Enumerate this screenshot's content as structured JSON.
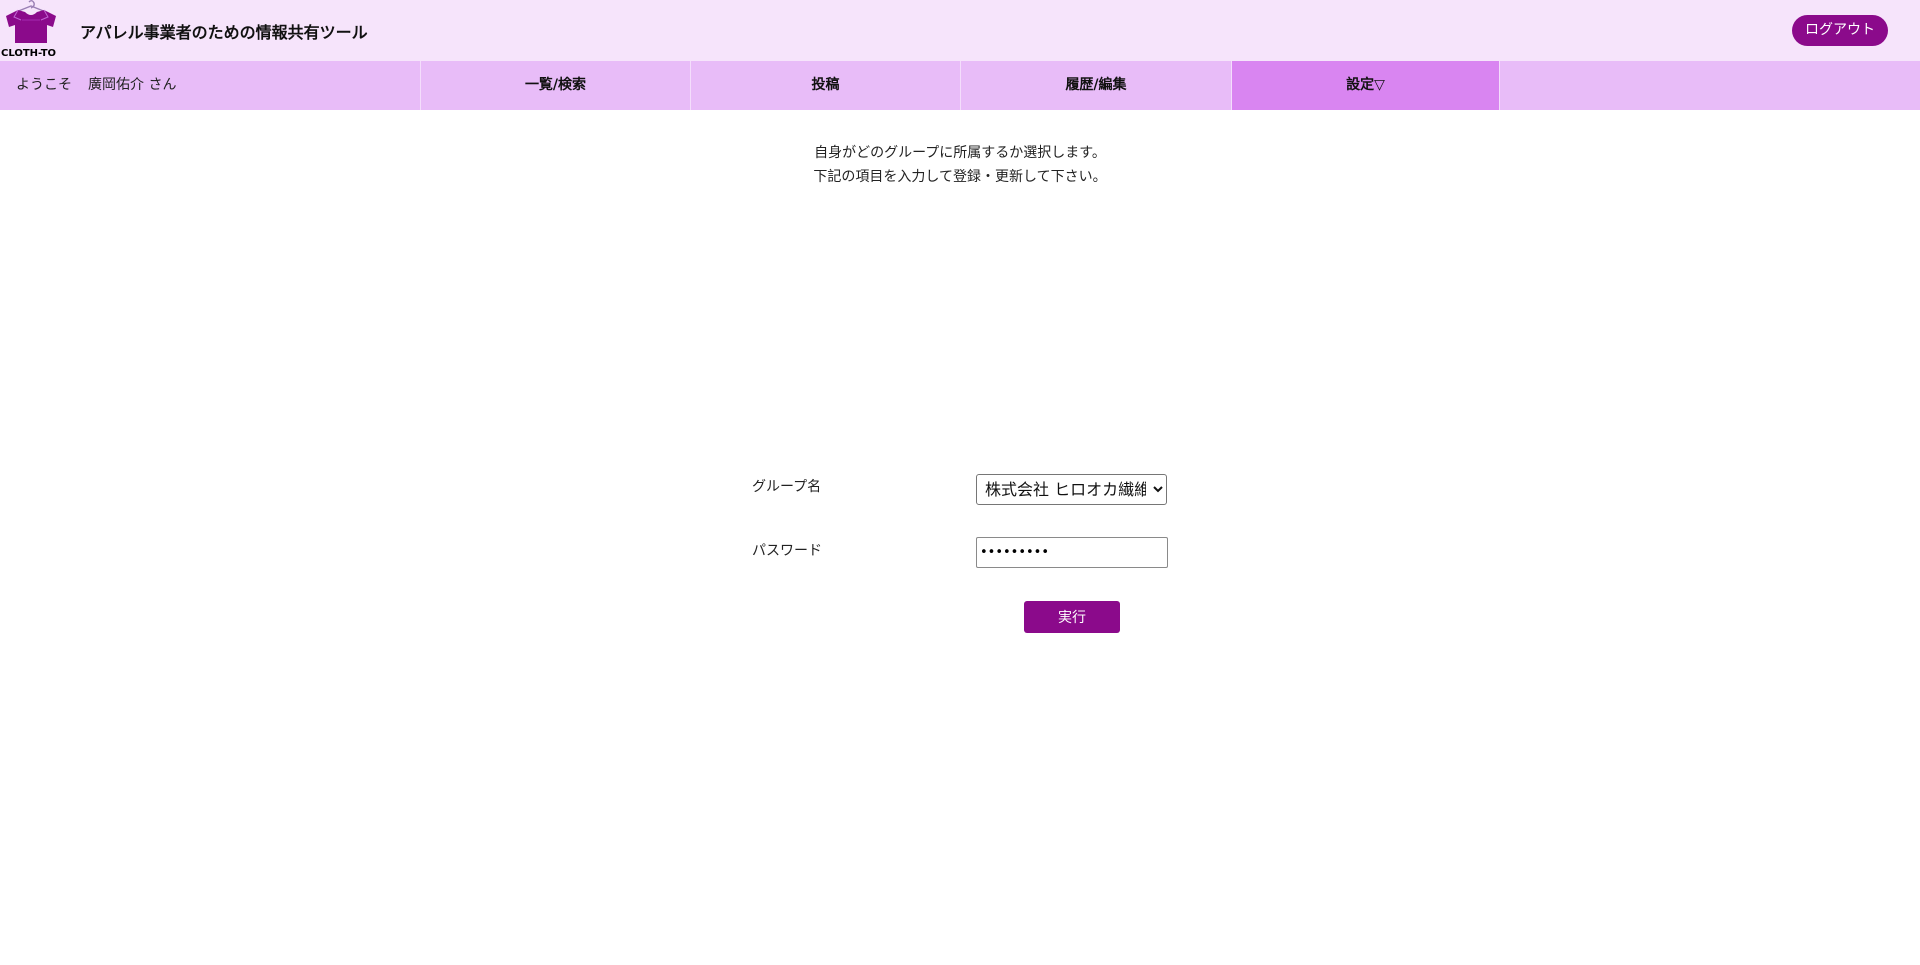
{
  "header": {
    "logo_text": "CLOTH-TO",
    "app_title": "アパレル事業者のための情報共有ツール",
    "logout_label": "ログアウト"
  },
  "nav": {
    "welcome_prefix": "ようこそ",
    "user_name": "廣岡佑介 さん",
    "items": [
      {
        "label": "一覧/検索"
      },
      {
        "label": "投稿"
      },
      {
        "label": "履歴/編集"
      },
      {
        "label": "設定▽",
        "active": true
      }
    ]
  },
  "instructions": {
    "line1": "自身がどのグループに所属するか選択します。",
    "line2": "下記の項目を入力して登録・更新して下さい。"
  },
  "form": {
    "group_label": "グループ名",
    "group_selected": "株式会社 ヒロオカ繊維",
    "password_label": "パスワード",
    "password_value": "•••••••••",
    "submit_label": "実行"
  },
  "colors": {
    "header_bg": "#f6e4fb",
    "nav_bg": "#e8bcf8",
    "nav_active_bg": "#d985f1",
    "accent": "#8b0a8b"
  },
  "icons": {
    "logo": "shirt-hanger-icon"
  }
}
